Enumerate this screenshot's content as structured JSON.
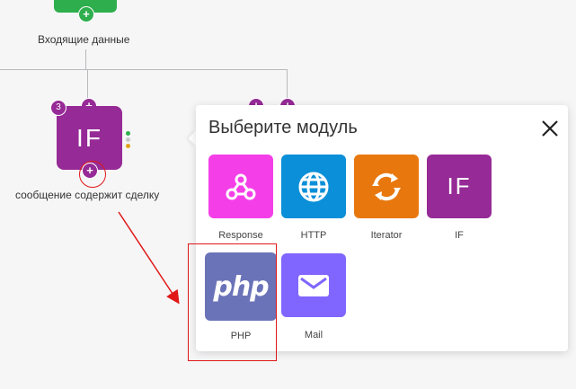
{
  "flow": {
    "input_node": {
      "label": "Входящие данные",
      "color": "#2eae4d"
    },
    "if_node": {
      "text": "IF",
      "badge": "3",
      "label": "сообщение содержит сделку",
      "color": "#962a96",
      "status_dots": [
        "#2eae4d",
        "#c9c9c9",
        "#e0a21b"
      ]
    },
    "plus_symbol": "+"
  },
  "popup": {
    "title": "Выберите модуль",
    "close_icon": "close-icon",
    "modules": [
      {
        "label": "Response",
        "icon": "webhook-icon",
        "color": "#f43fe8"
      },
      {
        "label": "HTTP",
        "icon": "globe-icon",
        "color": "#0a8fd8"
      },
      {
        "label": "Iterator",
        "icon": "iterator-icon",
        "color": "#e8780e"
      },
      {
        "label": "IF",
        "icon": "if-text-icon",
        "color": "#962a96",
        "text": "IF"
      },
      {
        "label": "PHP",
        "icon": "php-icon",
        "color": "#6b73b8",
        "text": "php"
      },
      {
        "label": "Mail",
        "icon": "mail-icon",
        "color": "#8066ff"
      }
    ]
  },
  "annotations": {
    "highlight_color": "#e01818"
  }
}
